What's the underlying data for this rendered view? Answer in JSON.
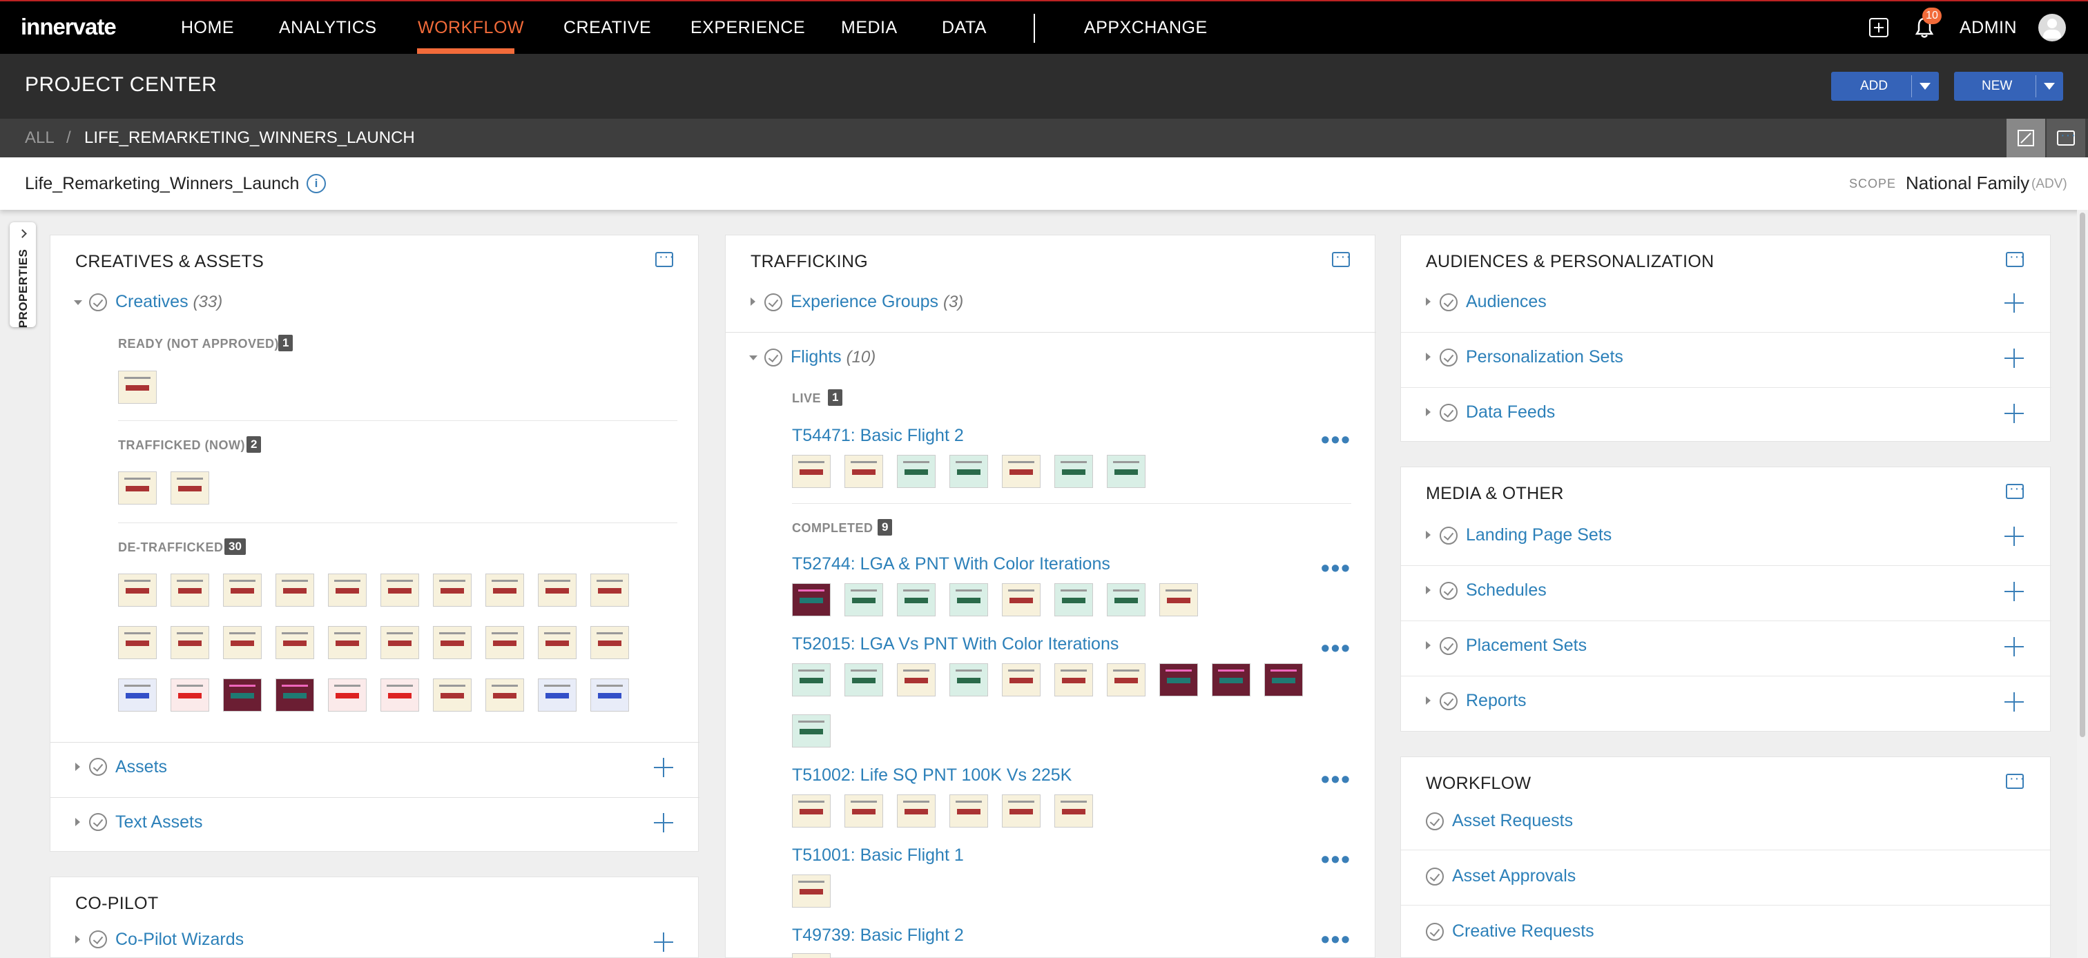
{
  "nav": {
    "logo": "innervate",
    "items": [
      {
        "label": "HOME"
      },
      {
        "label": "ANALYTICS"
      },
      {
        "label": "WORKFLOW"
      },
      {
        "label": "CREATIVE"
      },
      {
        "label": "EXPERIENCE"
      },
      {
        "label": "MEDIA"
      },
      {
        "label": "DATA"
      },
      {
        "label": "APPXCHANGE"
      }
    ],
    "active": "WORKFLOW",
    "notification_count": "10",
    "user_label": "ADMIN"
  },
  "project_center": {
    "title": "PROJECT CENTER",
    "add_label": "ADD",
    "new_label": "NEW"
  },
  "breadcrumb": {
    "root": "ALL",
    "separator": "/",
    "current": "LIFE_REMARKETING_WINNERS_LAUNCH"
  },
  "info": {
    "project_name": "Life_Remarketing_Winners_Launch",
    "scope_label": "SCOPE",
    "scope_value": "National Family",
    "scope_suffix": "(ADV)"
  },
  "properties_tab": {
    "label": "PROPERTIES"
  },
  "creatives_assets": {
    "title": "CREATIVES & ASSETS",
    "creatives_label": "Creatives",
    "creatives_count": "(33)",
    "groups": [
      {
        "label": "READY (NOT APPROVED)",
        "count": "1"
      },
      {
        "label": "TRAFFICKED (NOW)",
        "count": "2"
      },
      {
        "label": "DE-TRAFFICKED",
        "count": "30"
      }
    ],
    "assets_label": "Assets",
    "text_assets_label": "Text Assets"
  },
  "copilot": {
    "title": "CO-PILOT",
    "wizards_label": "Co-Pilot Wizards"
  },
  "trafficking": {
    "title": "TRAFFICKING",
    "experience_groups_label": "Experience Groups",
    "experience_groups_count": "(3)",
    "flights_label": "Flights",
    "flights_count": "(10)",
    "live_label": "LIVE",
    "live_count": "1",
    "completed_label": "COMPLETED",
    "completed_count": "9",
    "flights": [
      {
        "name": "T54471: Basic Flight 2"
      },
      {
        "name": "T52744: LGA & PNT With Color Iterations"
      },
      {
        "name": "T52015: LGA Vs PNT With Color Iterations"
      },
      {
        "name": "T51002: Life SQ PNT 100K Vs 225K"
      },
      {
        "name": "T51001: Basic Flight 1"
      },
      {
        "name": "T49739: Basic Flight 2"
      }
    ],
    "more_glyph": "•••"
  },
  "audiences": {
    "title": "AUDIENCES & PERSONALIZATION",
    "items": [
      {
        "label": "Audiences"
      },
      {
        "label": "Personalization Sets"
      },
      {
        "label": "Data Feeds"
      }
    ]
  },
  "media_other": {
    "title": "MEDIA & OTHER",
    "items": [
      {
        "label": "Landing Page Sets"
      },
      {
        "label": "Schedules"
      },
      {
        "label": "Placement Sets"
      },
      {
        "label": "Reports"
      }
    ]
  },
  "workflow": {
    "title": "WORKFLOW",
    "items": [
      {
        "label": "Asset Requests"
      },
      {
        "label": "Asset Approvals"
      },
      {
        "label": "Creative Requests"
      }
    ]
  },
  "colors": {
    "accent": "#f26b3a",
    "link": "#2c80b9",
    "button": "#3563b8"
  }
}
